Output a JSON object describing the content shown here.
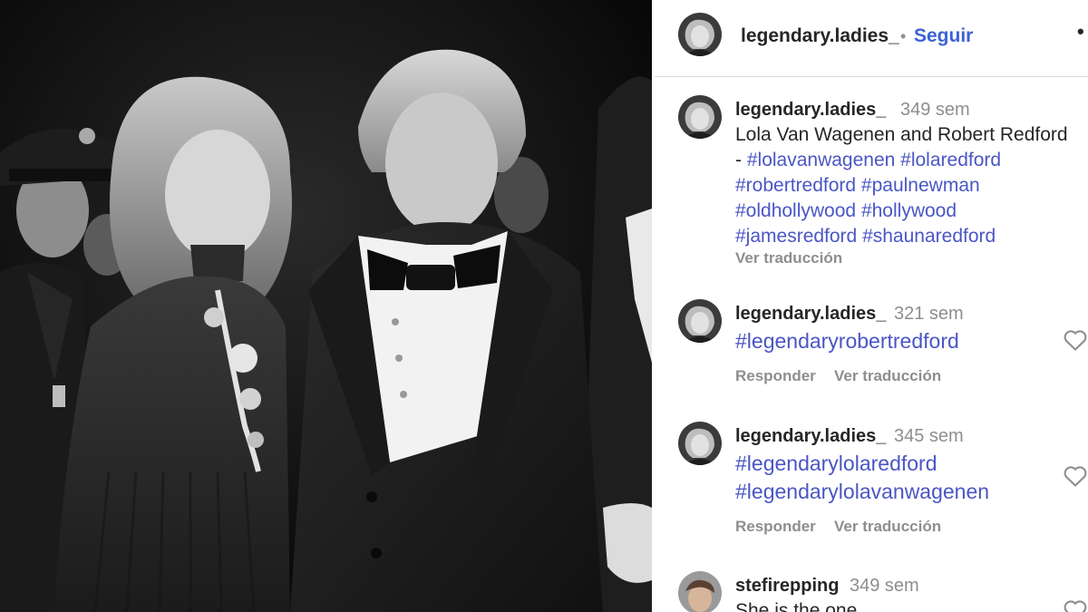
{
  "header": {
    "username": "legendary.ladies_",
    "separator": "•",
    "follow_label": "Seguir",
    "more_label": "•"
  },
  "caption": {
    "username": "legendary.ladies_",
    "time": "349 sem",
    "text": "Lola Van Wagenen and Robert Redford",
    "dash": "-",
    "hashtags": [
      "#lolavanwagenen",
      "#lolaredford",
      "#robertredford",
      "#paulnewman",
      "#oldhollywood",
      "#hollywood",
      "#jamesredford",
      "#shaunaredford"
    ],
    "translate_label": "Ver traducción"
  },
  "comments": [
    {
      "username": "legendary.ladies_",
      "time": "321 sem",
      "lines": [
        "#legendaryrobertredford"
      ],
      "reply_label": "Responder",
      "translate_label": "Ver traducción"
    },
    {
      "username": "legendary.ladies_",
      "time": "345 sem",
      "lines": [
        "#legendarylolaredford",
        "#legendarylolavanwagenen"
      ],
      "reply_label": "Responder",
      "translate_label": "Ver traducción"
    },
    {
      "username": "stefirepping",
      "time": "349 sem",
      "lines": [
        "She is the one"
      ]
    }
  ],
  "icons": {
    "like": "heart-icon",
    "more": "more-options-icon"
  },
  "colors": {
    "follow": "#3b62d6",
    "hashtag": "#4a56c4",
    "secondary_text": "#8e8e8e",
    "primary_text": "#262626"
  }
}
